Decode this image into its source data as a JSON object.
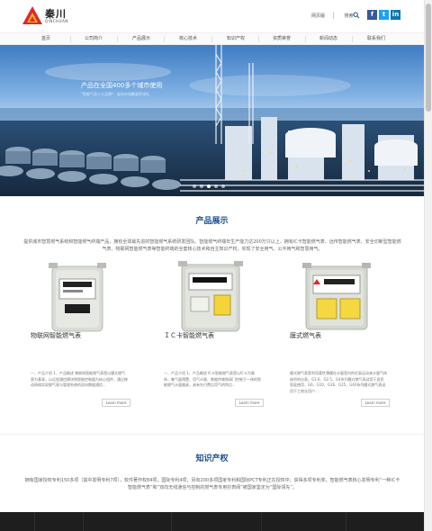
{
  "brand": {
    "name_cn": "秦川",
    "name_en": "QINCHUAN"
  },
  "header": {
    "links": [
      "网页版",
      "搜索"
    ],
    "social": [
      "f",
      "t",
      "in"
    ]
  },
  "nav": [
    "首页",
    "公司简介",
    "产品展示",
    "核心技术",
    "知识产权",
    "资质荣誉",
    "新闻动态",
    "联系我们"
  ],
  "banner": {
    "title": "产品在全国400多个城市使用",
    "subtitle": "*智能气表十大品牌* · 省份市场覆盖率领先"
  },
  "products": {
    "title": "产品展示",
    "desc": "提供城市智慧燃气系统和智能燃气终端产品，拥有全球最先进的智能燃气系统研发团队。智能燃气终端年生产能力达200万只以上，拥有IC卡智能燃气表、远传智能燃气表、安全切断型智能燃气表、物联网智能燃气表等智能终端的全套核心技术和自主知识产权，实现了安全用气、公平用气和智慧用气。",
    "items": [
      {
        "name": "物联网智能燃气表",
        "desc": "一、产品介绍 1、产品概述 物联网智能燃气表是以膜式燃气表为基表，以远程通信模块和智能控制器为核心组件，通过移动网络实现燃气表与管理系统的双向数据通信...",
        "more": "Learn more"
      },
      {
        "name": "ＩＣ卡智能燃气表",
        "desc": "一、产品介绍 1、产品概述 IC卡智能燃气表是以IC卡为载体，集气量预置、用气计量、数据传输和阀门控制于一体的智能燃气计量器具，具有先付费后用气的特点...",
        "more": "Learn more"
      },
      {
        "name": "膜式燃气表",
        "desc": "膜式燃气表是利用柔性薄膜在计量室内的往复运动来计量气体体积的仪表。G1.6、G2.5、G4系列膜式燃气表适用于居民家庭使用，G6、G10、G16、G25、G40系列膜式燃气表适用于工商业用户...",
        "more": "Learn more"
      }
    ]
  },
  "ip": {
    "title": "知识产权",
    "desc": "拥有国家授权专利150多项（其中发明专利7项），软件著作权84项，国际专利4项；另有200多项国家专利和国际PCT专利正在授权中；获得多项专利奖。智能燃气表核心发明专利“一种IC卡智能燃气表”和“双向无线通信与控制的燃气表专用抄表阀”被国家鉴定为“国际领先”。"
  },
  "colors": {
    "accent": "#1a4d8f",
    "logo_red": "#e1262d",
    "logo_yellow": "#f6b817"
  }
}
